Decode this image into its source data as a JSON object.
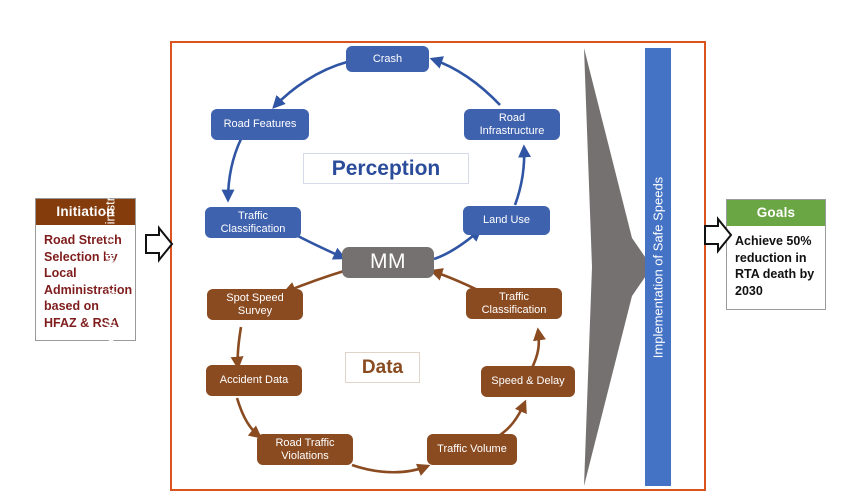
{
  "diagram": {
    "title_frame_color": "#D9541E",
    "initiation": {
      "header": "Initiation",
      "header_color": "#843C0C",
      "body": "Road Stretch Selection by Local Administration based on HFAZ & RSA",
      "body_color": "#7F1D1D"
    },
    "goals": {
      "header": "Goals",
      "header_color": "#6BA644",
      "body": "Achieve 50% reduction in RTA death by 2030",
      "body_color": "#111111"
    },
    "center_node": {
      "label": "MM",
      "color": "#767171"
    },
    "captions": {
      "perception": "Perception",
      "data": "Data"
    },
    "vertical_labels": {
      "validation": "Validation by Local Administration",
      "implementation": "Implementation of Safe Speeds"
    },
    "colors": {
      "perception_node": "#3F62AE",
      "data_node": "#8A4B21",
      "perception_arrow": "#2F55A4",
      "data_arrow": "#8A4B21",
      "gray_arrow": "#767171",
      "blue_bar": "#4472C4"
    },
    "perception_cycle": {
      "label": "Perception",
      "nodes": [
        {
          "id": "crash",
          "label": "Crash"
        },
        {
          "id": "road-features",
          "label": "Road Features"
        },
        {
          "id": "traffic-classification-top",
          "label": "Traffic Classification"
        },
        {
          "id": "land-use",
          "label": "Land Use"
        },
        {
          "id": "road-infrastructure",
          "label": "Road Infrastructure"
        }
      ],
      "flow": [
        "Crash -> Road Features",
        "Road Features -> Traffic Classification",
        "Traffic Classification -> MM",
        "MM -> Land Use",
        "Land Use -> Road Infrastructure",
        "Road Infrastructure -> Crash"
      ]
    },
    "data_cycle": {
      "label": "Data",
      "nodes": [
        {
          "id": "spot-speed-survey",
          "label": "Spot Speed Survey"
        },
        {
          "id": "accident-data",
          "label": "Accident Data"
        },
        {
          "id": "road-traffic-violations",
          "label": "Road Traffic Violations"
        },
        {
          "id": "traffic-volume",
          "label": "Traffic Volume"
        },
        {
          "id": "speed-and-delay",
          "label": "Speed & Delay"
        },
        {
          "id": "traffic-classification-bottom",
          "label": "Traffic Classification"
        }
      ],
      "flow": [
        "MM -> Spot Speed Survey",
        "Spot Speed Survey -> Accident Data",
        "Accident Data -> Road Traffic Violations",
        "Road Traffic Violations -> Traffic Volume",
        "Traffic Volume -> Speed & Delay",
        "Speed & Delay -> Traffic Classification",
        "Traffic Classification -> MM"
      ]
    }
  }
}
